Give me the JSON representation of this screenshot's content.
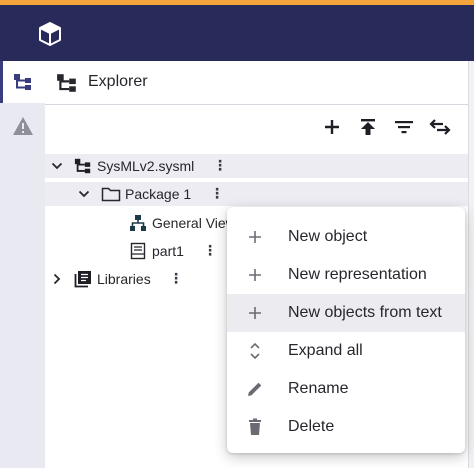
{
  "app": {
    "logo_icon": "cube-icon",
    "accent_color": "#f3a43a",
    "header_color": "#282a5a"
  },
  "sidebar": {
    "tools": [
      {
        "icon": "explorer-tree-icon",
        "active": true
      },
      {
        "icon": "warning-icon",
        "active": false
      }
    ]
  },
  "explorer": {
    "title": "Explorer",
    "toolbar": [
      {
        "icon": "plus-icon"
      },
      {
        "icon": "upload-icon"
      },
      {
        "icon": "filter-icon"
      },
      {
        "icon": "swap-icon"
      }
    ],
    "tree": [
      {
        "label": "SysMLv2.sysml",
        "icon": "model-tree-icon",
        "expanded": true,
        "selected": true
      },
      {
        "label": "Package 1",
        "icon": "folder-icon",
        "expanded": true,
        "selected": true
      },
      {
        "label": "General View",
        "icon": "diagram-icon"
      },
      {
        "label": "part1",
        "icon": "part-icon"
      },
      {
        "label": "Libraries",
        "icon": "library-icon",
        "expanded": false
      }
    ]
  },
  "context_menu": {
    "items": [
      {
        "label": "New object",
        "icon": "plus-icon"
      },
      {
        "label": "New representation",
        "icon": "plus-icon"
      },
      {
        "label": "New objects from text",
        "icon": "plus-icon",
        "hovered": true
      },
      {
        "label": "Expand all",
        "icon": "unfold-icon"
      },
      {
        "label": "Rename",
        "icon": "pencil-icon"
      },
      {
        "label": "Delete",
        "icon": "trash-icon"
      }
    ]
  }
}
